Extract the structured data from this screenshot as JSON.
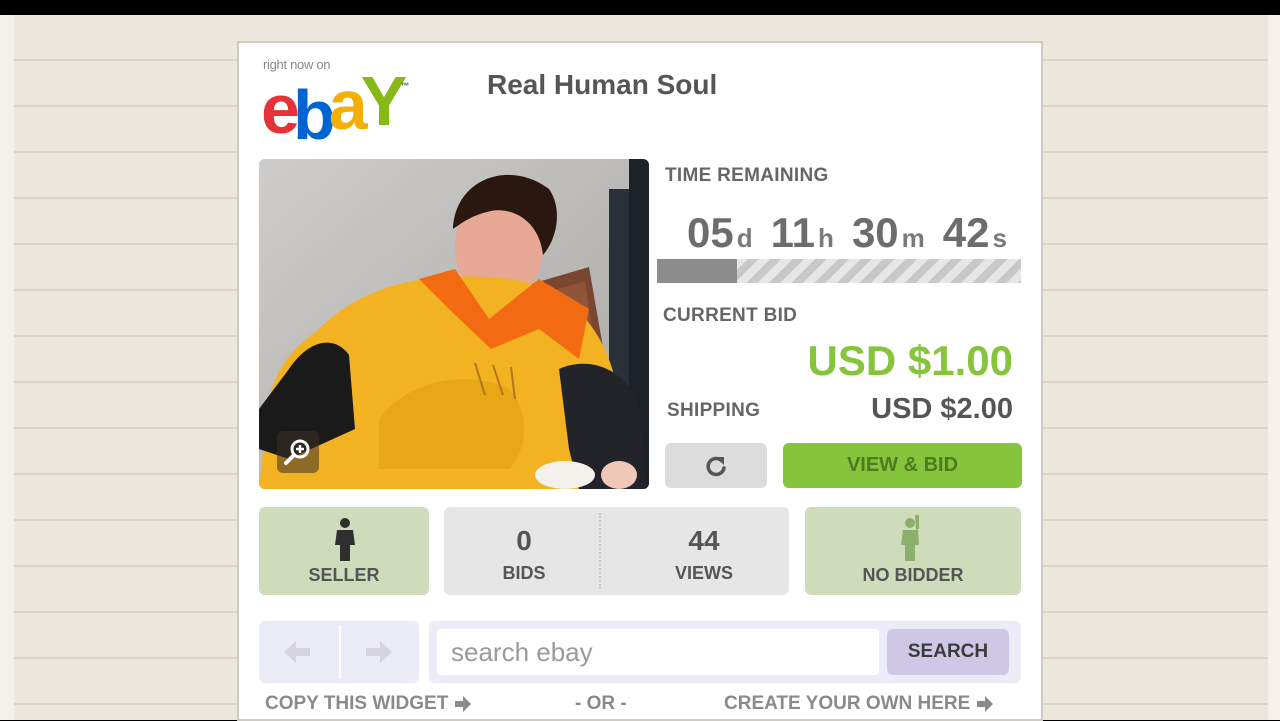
{
  "header": {
    "tagline": "right now on",
    "logo_letters": [
      "e",
      "b",
      "a",
      "Y"
    ],
    "logo_tm": "™",
    "item_title": "Real Human Soul"
  },
  "photo": {
    "description_icon": "zoom-icon"
  },
  "timer": {
    "label": "TIME REMAINING",
    "days": "05",
    "days_suffix": "d",
    "hours": "11",
    "hours_suffix": "h",
    "minutes": "30",
    "minutes_suffix": "m",
    "seconds": "42",
    "seconds_suffix": "s",
    "elapsed_fraction": 0.22
  },
  "bid": {
    "current_label": "CURRENT BID",
    "current_value": "USD $1.00",
    "shipping_label": "SHIPPING",
    "shipping_value": "USD $2.00",
    "refresh_icon": "refresh-icon",
    "view_bid_label": "VIEW & BID"
  },
  "stats": {
    "seller_label": "SELLER",
    "seller_icon": "person-icon",
    "bids_count": "0",
    "bids_label": "BIDS",
    "views_count": "44",
    "views_label": "VIEWS",
    "bidder_label": "NO BIDDER",
    "bidder_icon": "waving-person-icon"
  },
  "search": {
    "placeholder": "search ebay",
    "button_label": "SEARCH",
    "prev_icon": "arrow-left-icon",
    "next_icon": "arrow-right-icon"
  },
  "footer": {
    "copy_label": "COPY THIS WIDGET",
    "or_label": "- OR -",
    "create_label": "CREATE YOUR OWN HERE"
  },
  "colors": {
    "accent_green": "#86c43b",
    "stat_green": "#cfdcbc",
    "search_lavender": "#cfc7e6",
    "ebay_red": "#e53238",
    "ebay_blue": "#0064d2",
    "ebay_yellow": "#f5af02",
    "ebay_green": "#86b817"
  }
}
